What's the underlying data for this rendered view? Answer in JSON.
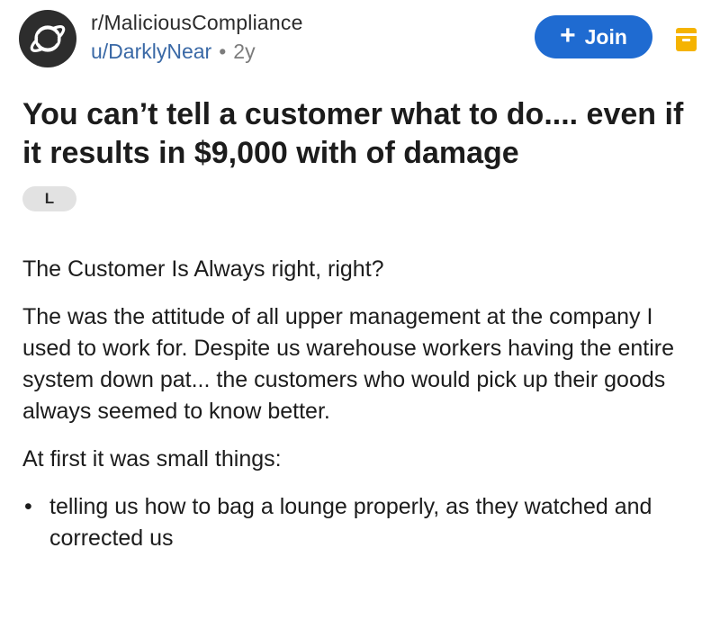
{
  "post": {
    "subreddit": "r/MaliciousCompliance",
    "username": "u/DarklyNear",
    "separator": "•",
    "age": "2y",
    "join_label": "Join",
    "join_icon": "+",
    "title": "You can’t tell a customer what to do.... even if it results in $9,000 with of damage",
    "flair": "L",
    "paragraphs": [
      "The Customer Is Always right, right?",
      "The was the attitude of all upper management at the company I used to work for. Despite us warehouse workers having the entire system down pat... the customers who would pick up their goods always seemed to know better.",
      "At first it was small things:"
    ],
    "bullets": [
      "telling us how to bag a lounge properly, as they watched and corrected us"
    ],
    "bullet_symbol": "•"
  },
  "colors": {
    "join_button": "#1f6bd1",
    "username": "#3a69a6",
    "save_icon": "#f5b301",
    "flair_bg": "#e2e2e2",
    "avatar_bg": "#2d2d2d"
  },
  "icons": {
    "avatar": "planet-icon",
    "save": "save-icon",
    "join": "plus-icon"
  }
}
